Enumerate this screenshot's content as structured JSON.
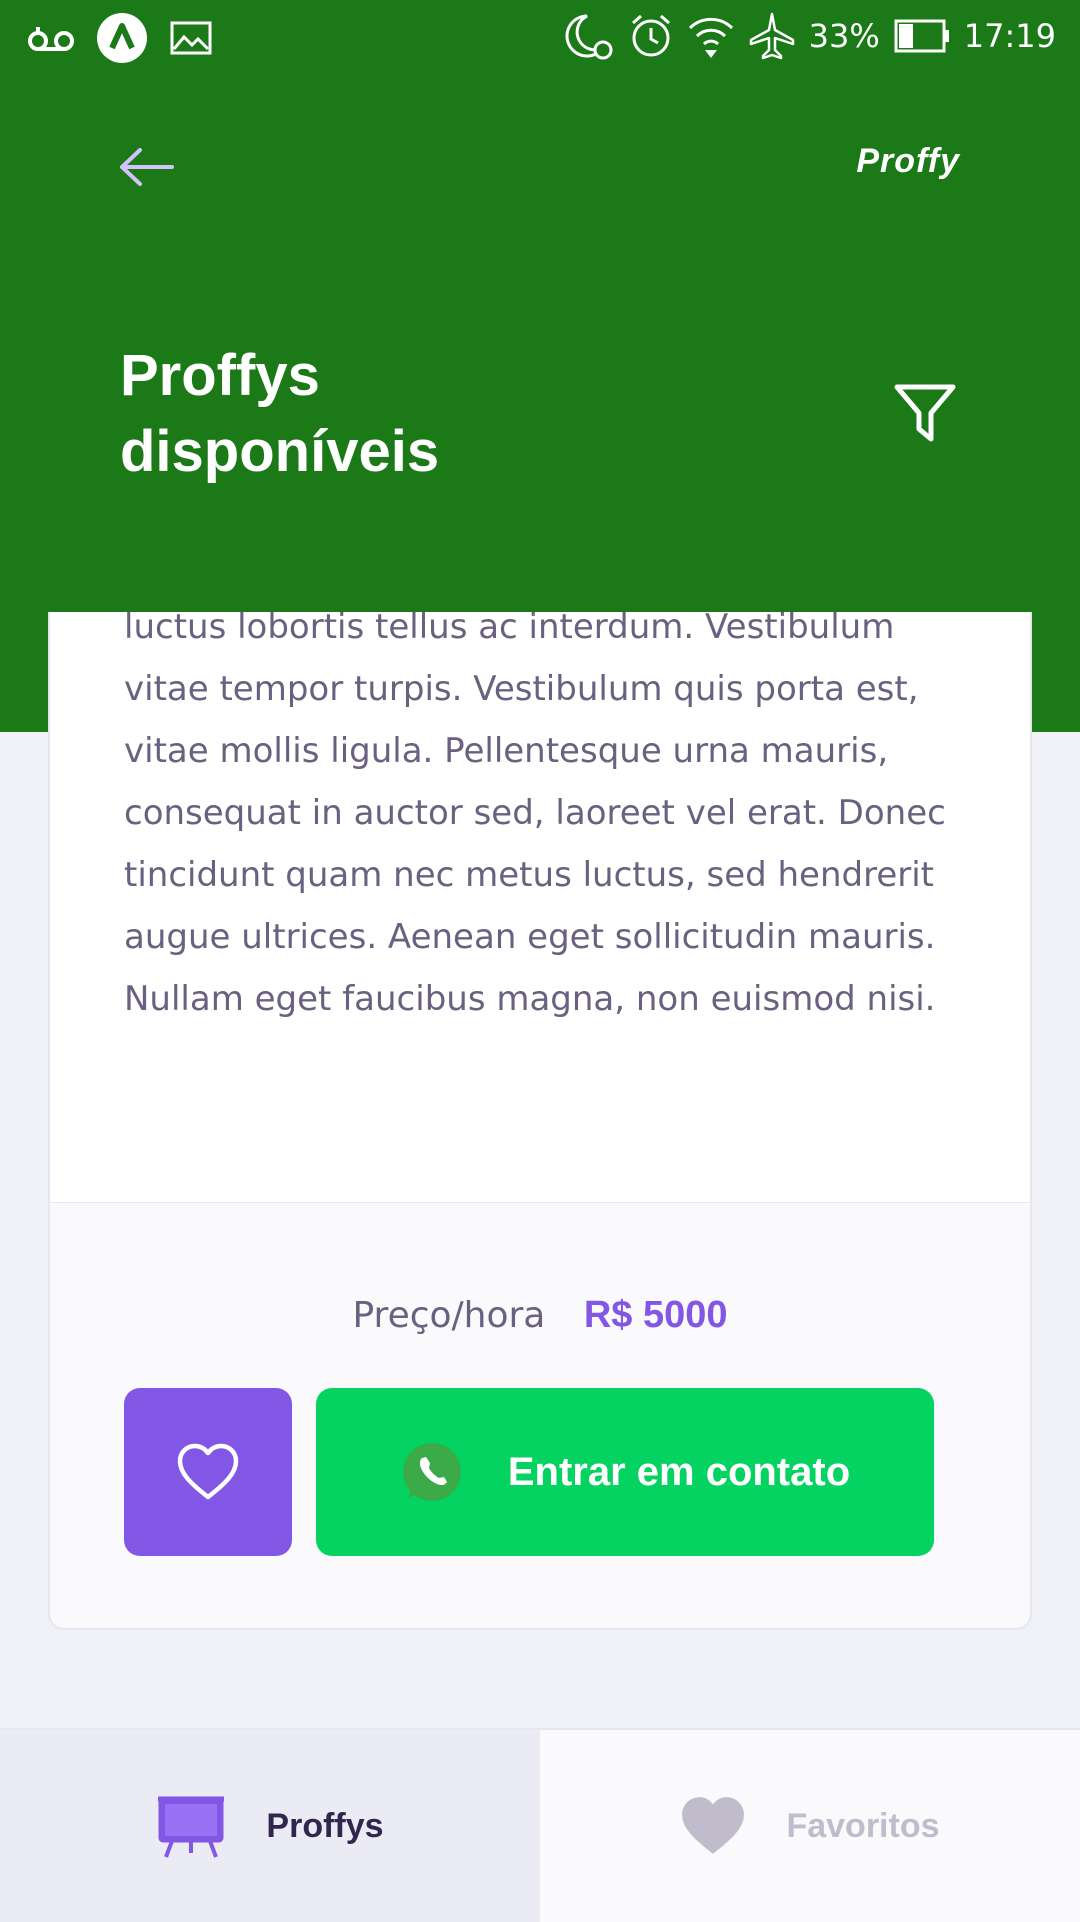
{
  "status_bar": {
    "battery": "33%",
    "time": "17:19"
  },
  "header": {
    "brand": "Proffy",
    "title_line1": "Proffys",
    "title_line2": "disponíveis"
  },
  "card": {
    "bio": "luctus lobortis tellus ac interdum. Vestibulum vitae tempor turpis. Vestibulum quis porta est, vitae mollis ligula. Pellentesque urna mauris, consequat in auctor sed, laoreet vel erat. Donec tincidunt quam nec metus luctus, sed hendrerit augue ultrices. Aenean eget sollicitudin mauris. Nullam eget faucibus magna, non euismod nisi.",
    "price_label": "Preço/hora",
    "price_value": "R$ 5000",
    "contact_label": "Entrar em contato"
  },
  "tabs": {
    "proffys": "Proffys",
    "favoritos": "Favoritos"
  },
  "colors": {
    "header": "#1B7A17",
    "accent_purple": "#8257E5",
    "whatsapp_green": "#04D361"
  },
  "icons": [
    "voicemail-icon",
    "app-icon",
    "image-icon",
    "night-alarm-icon",
    "alarm-icon",
    "wifi-icon",
    "airplane-icon",
    "battery-icon",
    "back-arrow-icon",
    "filter-icon",
    "heart-icon",
    "whatsapp-icon",
    "easel-icon",
    "heart-filled-icon"
  ]
}
